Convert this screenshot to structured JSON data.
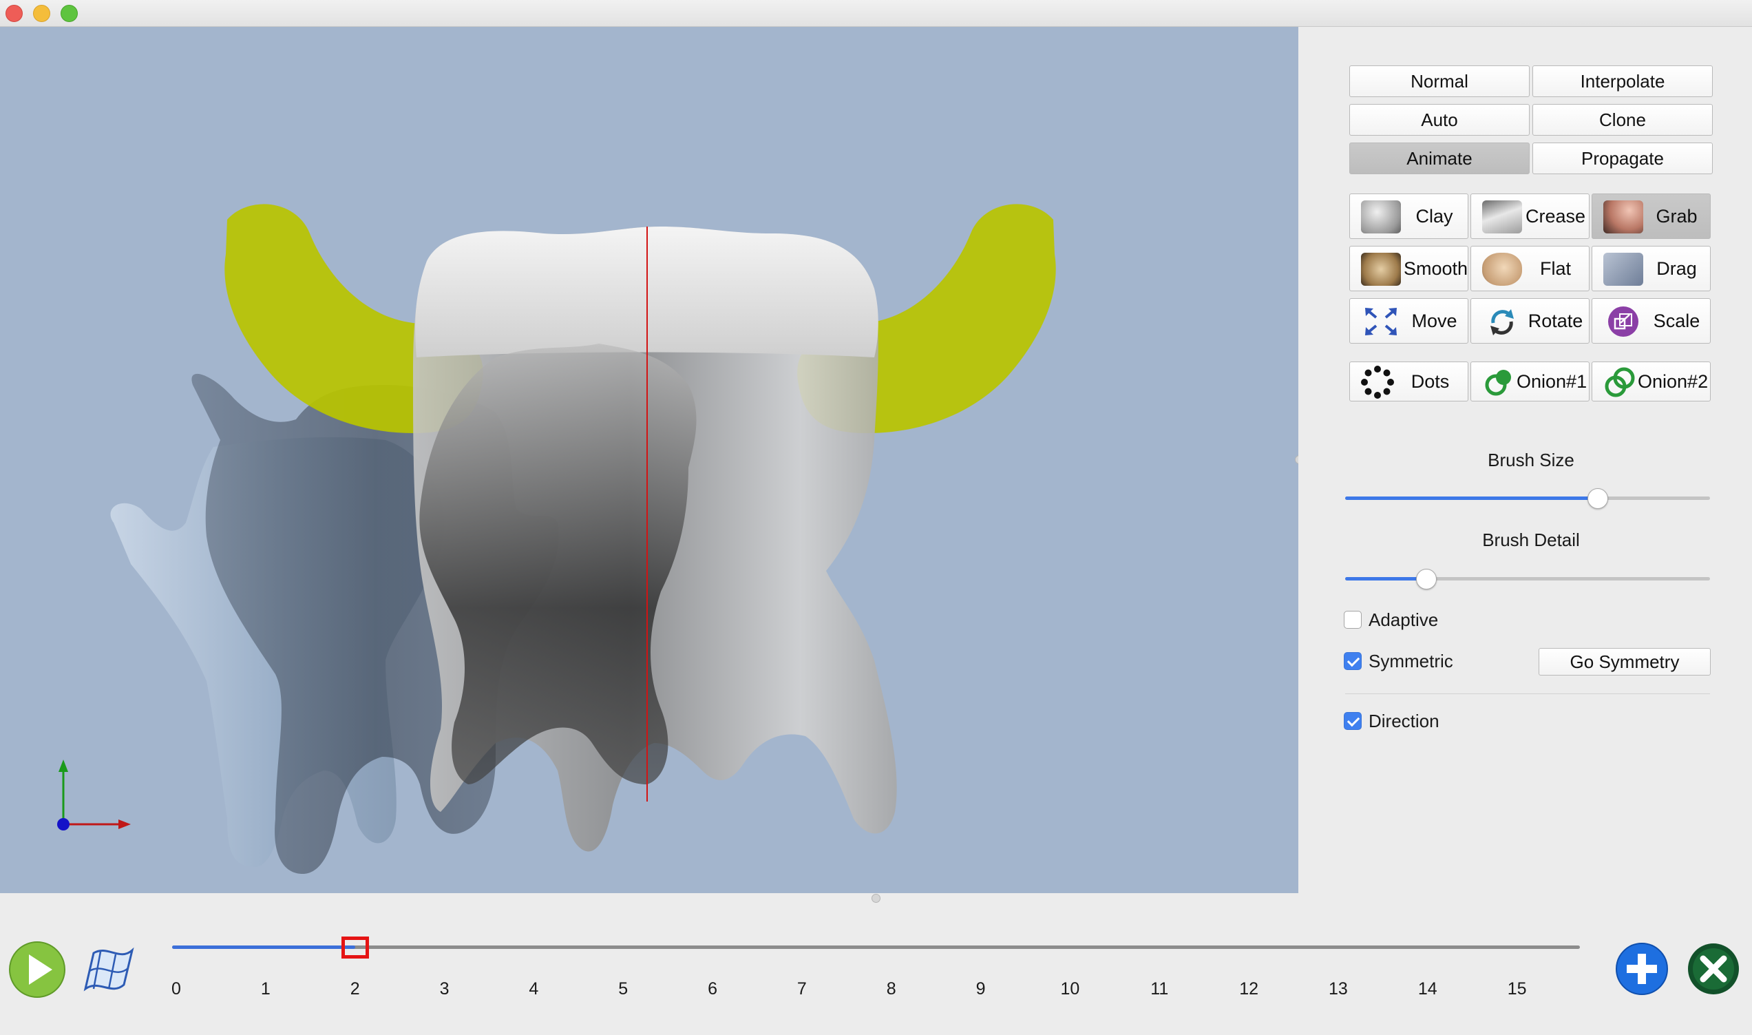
{
  "window": {
    "title": ""
  },
  "panel": {
    "modes": [
      {
        "label": "Normal",
        "active": false
      },
      {
        "label": "Interpolate",
        "active": false
      },
      {
        "label": "Auto",
        "active": false
      },
      {
        "label": "Clone",
        "active": false
      },
      {
        "label": "Animate",
        "active": true
      },
      {
        "label": "Propagate",
        "active": false
      }
    ],
    "tools": [
      {
        "label": "Clay",
        "icon": "clay-brush-icon",
        "active": false
      },
      {
        "label": "Crease",
        "icon": "crease-brush-icon",
        "active": false
      },
      {
        "label": "Grab",
        "icon": "grab-brush-icon",
        "active": true
      },
      {
        "label": "Smooth",
        "icon": "smooth-brush-icon",
        "active": false
      },
      {
        "label": "Flat",
        "icon": "flat-brush-icon",
        "active": false
      },
      {
        "label": "Drag",
        "icon": "drag-brush-icon",
        "active": false
      },
      {
        "label": "Move",
        "icon": "move-icon",
        "active": false
      },
      {
        "label": "Rotate",
        "icon": "rotate-icon",
        "active": false
      },
      {
        "label": "Scale",
        "icon": "scale-icon",
        "active": false
      }
    ],
    "views": [
      {
        "label": "Dots",
        "icon": "dots-icon"
      },
      {
        "label": "Onion#1",
        "icon": "onion-one-icon"
      },
      {
        "label": "Onion#2",
        "icon": "onion-two-icon"
      }
    ],
    "brush_size": {
      "label": "Brush Size",
      "value": 0.69
    },
    "brush_detail": {
      "label": "Brush Detail",
      "value": 0.22
    },
    "adaptive": {
      "label": "Adaptive",
      "checked": false
    },
    "symmetric": {
      "label": "Symmetric",
      "checked": true
    },
    "go_symmetry": {
      "label": "Go Symmetry"
    },
    "direction": {
      "label": "Direction",
      "checked": true
    }
  },
  "timeline": {
    "ticks": [
      "0",
      "1",
      "2",
      "3",
      "4",
      "5",
      "6",
      "7",
      "8",
      "9",
      "10",
      "11",
      "12",
      "13",
      "14",
      "15"
    ],
    "current_frame": 2,
    "max_frame": 15.75,
    "play_icon": "play-icon",
    "curve_icon": "curve-editor-icon",
    "add_icon": "add-keyframe-icon",
    "delete_icon": "delete-keyframe-icon"
  },
  "colors": {
    "viewport_bg": "#a3b5cd",
    "accent": "#3d78e8",
    "handle": "#e51414",
    "onion_highlight": "#b8c400"
  }
}
